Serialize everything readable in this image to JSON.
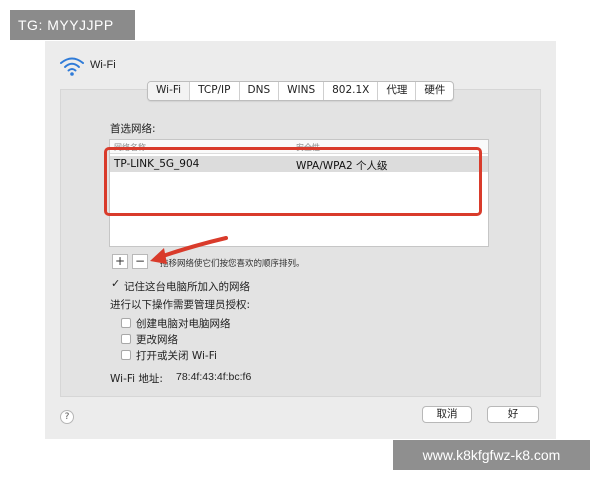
{
  "watermarks": {
    "top_left": "TG: MYYJJPP",
    "bottom_right": "www.k8kfgfwz-k8.com"
  },
  "header": {
    "title": "Wi-Fi",
    "icon": "wifi-icon"
  },
  "tabs": [
    "Wi-Fi",
    "TCP/IP",
    "DNS",
    "WINS",
    "802.1X",
    "代理",
    "硬件"
  ],
  "preferred": {
    "label": "首选网络:",
    "columns": [
      "网络名称",
      "安全性"
    ],
    "rows": [
      {
        "name": "TP-LINK_5G_904",
        "security": "WPA/WPA2 个人级"
      }
    ],
    "add_label": "+",
    "remove_label": "−",
    "hint": "拖移网络使它们按您喜欢的顺序排列。"
  },
  "options": {
    "remember": {
      "label": "记住这台电脑所加入的网络",
      "checked": true
    },
    "admin_label": "进行以下操作需要管理员授权:",
    "admin_items": [
      {
        "label": "创建电脑对电脑网络",
        "checked": false
      },
      {
        "label": "更改网络",
        "checked": false
      },
      {
        "label": "打开或关闭 Wi-Fi",
        "checked": false
      }
    ]
  },
  "address": {
    "label": "Wi-Fi 地址:",
    "value": "78:4f:43:4f:bc:f6"
  },
  "footer": {
    "help": "?",
    "cancel": "取消",
    "ok": "好"
  },
  "colors": {
    "highlight": "#d93b2b",
    "window_bg": "#ececec",
    "accent": "#2f7bd8"
  }
}
